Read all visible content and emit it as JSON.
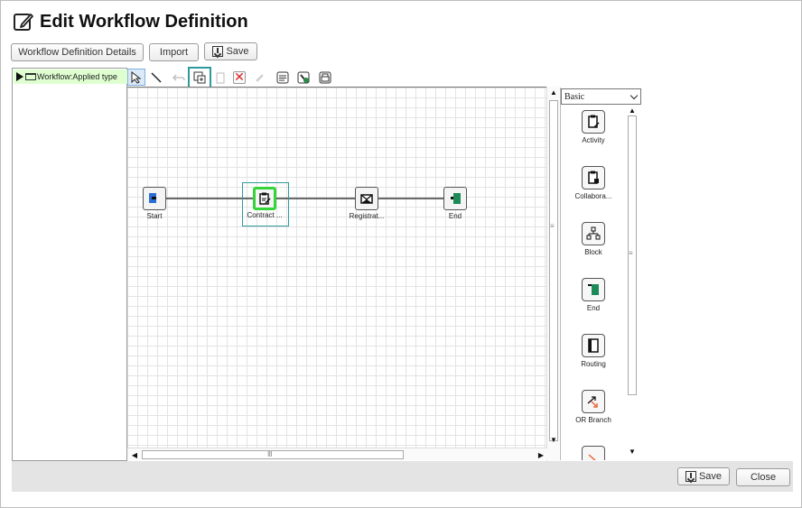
{
  "page": {
    "title": "Edit Workflow Definition"
  },
  "header_buttons": {
    "details_label": "Workflow Definition Details",
    "import_label": "Import",
    "save_label": "Save"
  },
  "tree": {
    "root_label": "Workflow:Applied type"
  },
  "toolbar": {
    "tools": [
      "select-icon",
      "line-icon",
      "undo-icon",
      "copy-icon",
      "paste-icon",
      "delete-icon",
      "edit-icon",
      "properties-icon",
      "validate-icon",
      "print-icon"
    ],
    "active_tool": "select-icon",
    "highlighted_tool": "copy-icon"
  },
  "diagram": {
    "nodes": [
      {
        "id": "start",
        "label": "Start",
        "icon": "start-flag-icon",
        "color": "#2b6fd6"
      },
      {
        "id": "contract",
        "label": "Contract ...",
        "icon": "clipboard-edit-icon",
        "selected": true
      },
      {
        "id": "registration",
        "label": "Registrat...",
        "icon": "envelope-icon"
      },
      {
        "id": "end",
        "label": "End",
        "icon": "end-flag-icon",
        "color": "#1d8a57"
      }
    ]
  },
  "palette": {
    "category": "Basic",
    "items": [
      {
        "label": "Activity",
        "icon": "activity-icon"
      },
      {
        "label": "Collabora...",
        "icon": "collaboration-icon"
      },
      {
        "label": "Block",
        "icon": "block-icon"
      },
      {
        "label": "End",
        "icon": "end-icon",
        "color": "#1d8a57"
      },
      {
        "label": "Routing",
        "icon": "routing-icon"
      },
      {
        "label": "OR Branch",
        "icon": "or-branch-icon",
        "color": "#e8683a"
      }
    ]
  },
  "footer": {
    "save_label": "Save",
    "close_label": "Close"
  }
}
